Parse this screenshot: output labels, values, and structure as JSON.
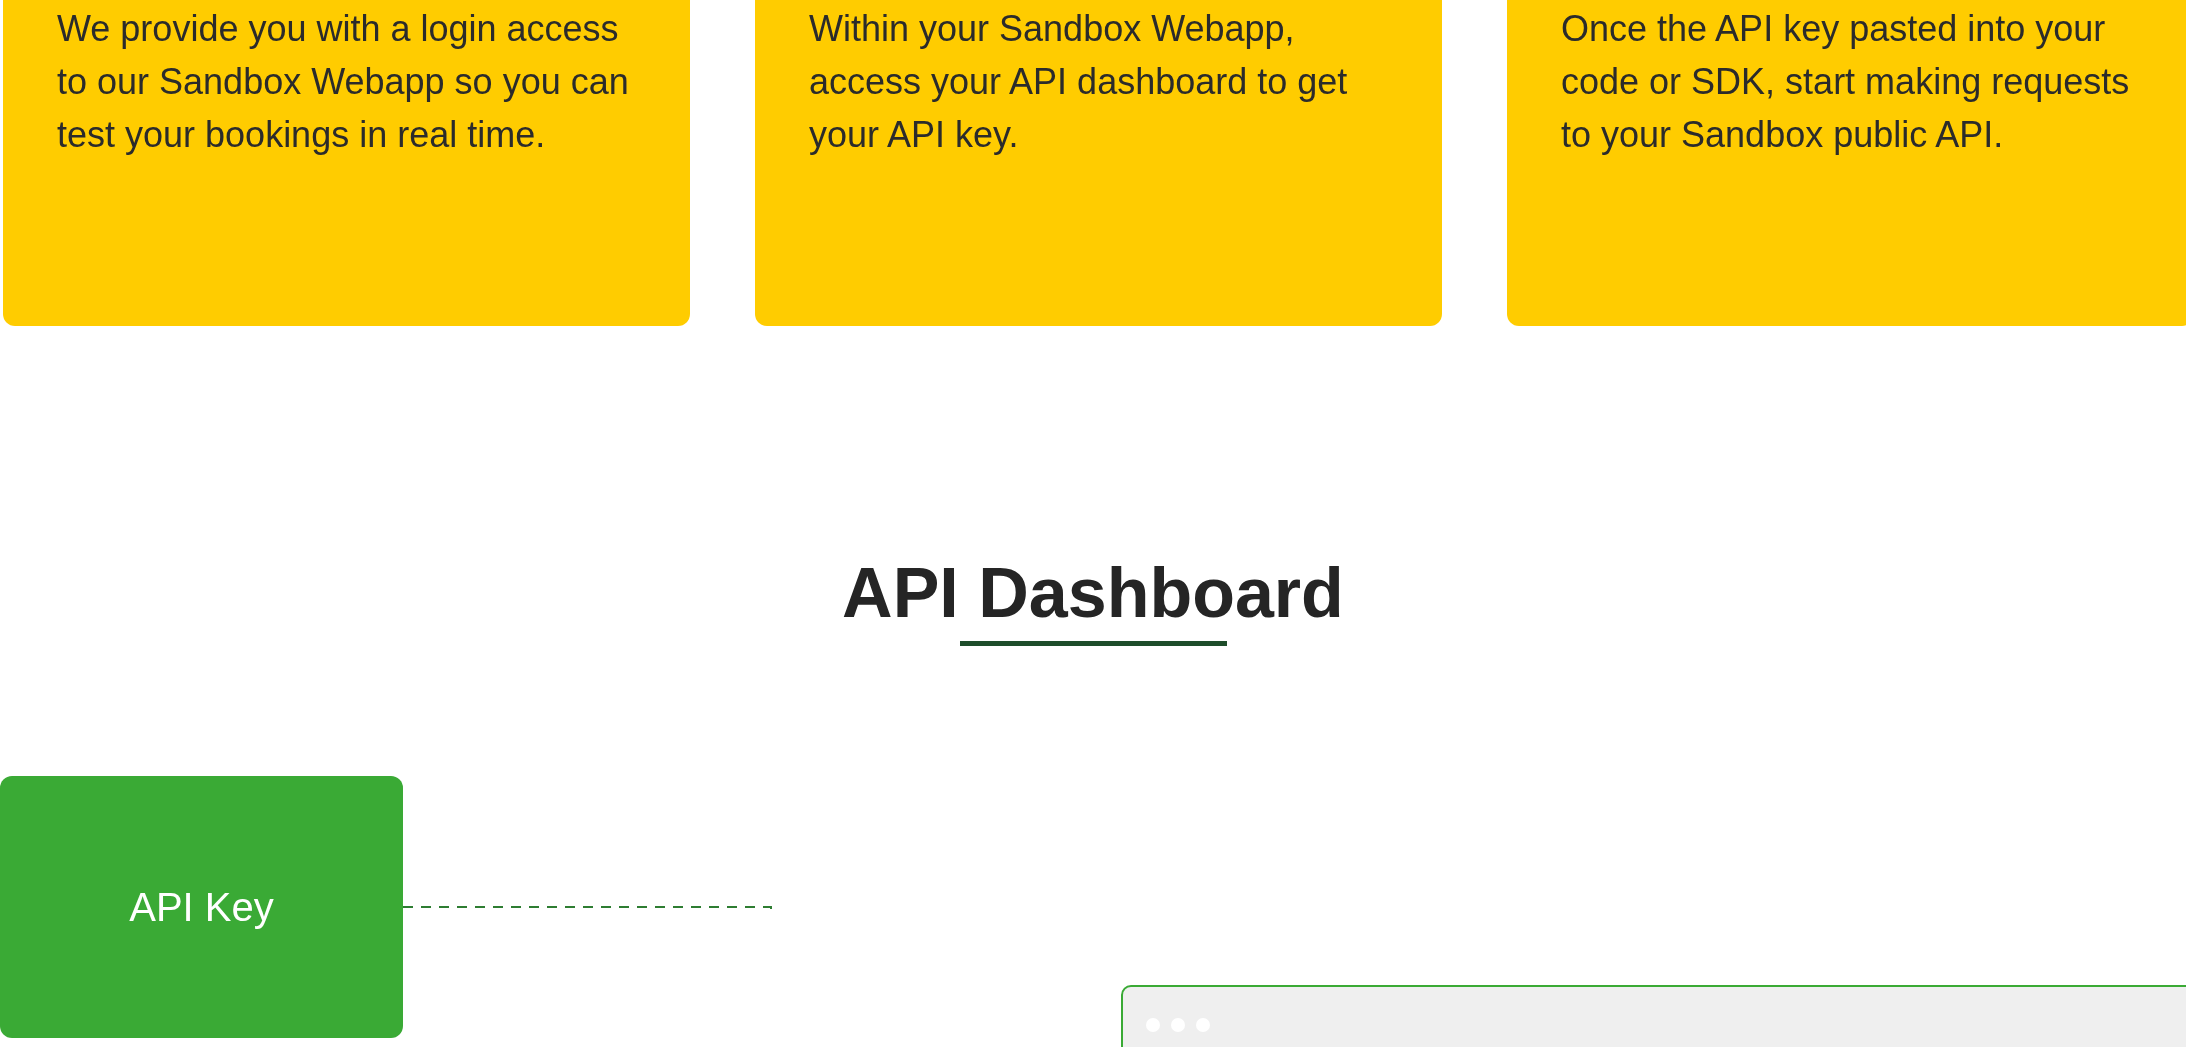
{
  "steps": [
    {
      "text": "We provide you with a login access to our Sandbox Webapp so you can test your bookings in real time."
    },
    {
      "text": "Within your Sandbox Webapp, access your API dashboard to get your API key."
    },
    {
      "text": "Once the API key pasted into your code or SDK, start making requests to your Sandbox public API."
    }
  ],
  "section": {
    "title": "API Dashboard"
  },
  "diagram": {
    "key_label": "API Key"
  }
}
